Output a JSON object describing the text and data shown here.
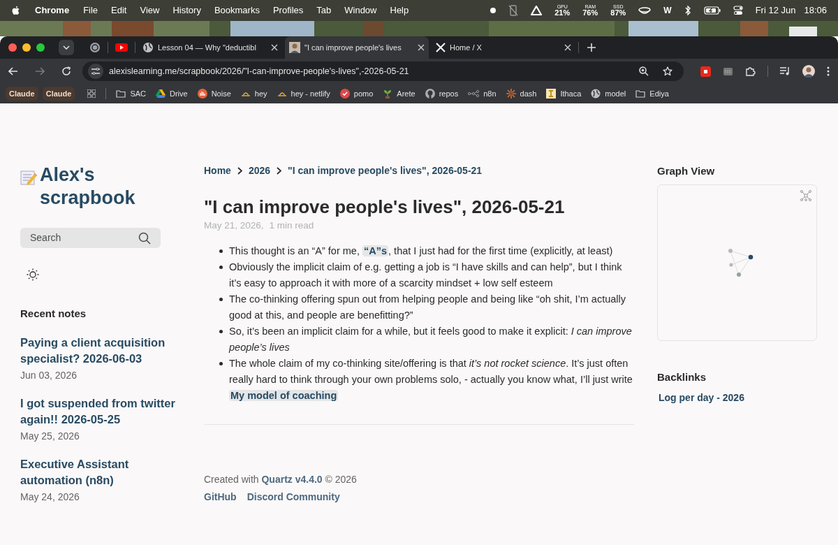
{
  "menu_bar": {
    "app": "Chrome",
    "items": [
      "File",
      "Edit",
      "View",
      "History",
      "Bookmarks",
      "Profiles",
      "Tab",
      "Window",
      "Help"
    ],
    "stats": [
      {
        "label": "GPU",
        "value": "21%"
      },
      {
        "label": "RAM",
        "value": "76%"
      },
      {
        "label": "SSD",
        "value": "87%"
      }
    ],
    "w_label": "W",
    "date": "Fri 12 Jun",
    "time": "18:06"
  },
  "tabs": [
    {
      "title": "Lesson 04 — Why \"deductibl",
      "selected": false,
      "kind": "globe"
    },
    {
      "title": "\"I can improve people's lives",
      "selected": true,
      "kind": "avatar"
    },
    {
      "title": "Home / X",
      "selected": false,
      "kind": "x"
    }
  ],
  "url": "alexislearning.me/scrapbook/2026/\"I-can-improve-people's-lives\",-2026-05-21",
  "bookmarks": [
    {
      "label": "Claude",
      "kind": "badge"
    },
    {
      "label": "Claude",
      "kind": "badge"
    },
    {
      "label": "SAC",
      "kind": "folder"
    },
    {
      "label": "Drive",
      "kind": "drive"
    },
    {
      "label": "Noise",
      "kind": "noise"
    },
    {
      "label": "hey",
      "kind": "hey"
    },
    {
      "label": "hey - netlify",
      "kind": "hey"
    },
    {
      "label": "pomo",
      "kind": "pomo"
    },
    {
      "label": "Arete",
      "kind": "sprout"
    },
    {
      "label": "repos",
      "kind": "github"
    },
    {
      "label": "n8n",
      "kind": "n8n"
    },
    {
      "label": "dash",
      "kind": "dash"
    },
    {
      "label": "Ithaca",
      "kind": "ithaca"
    },
    {
      "label": "model",
      "kind": "globe"
    },
    {
      "label": "Ediya",
      "kind": "folder"
    }
  ],
  "sidebar": {
    "site_title": "Alex's scrapbook",
    "search_placeholder": "Search",
    "recent_heading": "Recent notes",
    "recent_notes": [
      {
        "title": "Paying a client acquisition specialist? 2026-06-03",
        "date": "Jun 03, 2026"
      },
      {
        "title": "I got suspended from twitter again!! 2026-05-25",
        "date": "May 25, 2026"
      },
      {
        "title": "Executive Assistant automation (n8n)",
        "date": "May 24, 2026"
      }
    ]
  },
  "breadcrumbs": [
    "Home",
    "2026",
    "\"I can improve people's lives\", 2026-05-21"
  ],
  "article": {
    "title": "\"I can improve people's lives\", 2026-05-21",
    "meta": [
      "May 21, 2026,",
      "1 min read"
    ],
    "bullets": [
      [
        {
          "kind": "text",
          "text": "This thought is an “A” for me, "
        },
        {
          "kind": "link",
          "text": "“A”s"
        },
        {
          "kind": "text",
          "text": ", that I just had for the first time (explicitly, at least)"
        }
      ],
      [
        {
          "kind": "text",
          "text": "Obviously the implicit claim of e.g. getting a job is “I have skills and can help”, but I think it’s easy to approach it with more of a scarcity mindset + low self esteem"
        }
      ],
      [
        {
          "kind": "text",
          "text": "The co-thinking offering spun out from helping people and being like “oh shit, I’m actually good at this, and people are benefitting?”"
        }
      ],
      [
        {
          "kind": "text",
          "text": "So, it’s been an implicit claim for a while, but it feels good to make it explicit: *I can improve people’s lives*"
        }
      ],
      [
        {
          "kind": "text",
          "text": "The whole claim of my co-thinking site/offering is that *it’s not rocket science*. It’s just often really hard to think through your own problems solo, - actually you know what, I’ll just write "
        },
        {
          "kind": "link",
          "text": "My model of coaching"
        }
      ]
    ]
  },
  "footer": {
    "credit": [
      {
        "kind": "text",
        "text": "Created with "
      },
      {
        "kind": "link",
        "text": "Quartz v4.4.0"
      },
      {
        "kind": "text",
        "text": " © 2026"
      }
    ],
    "links": [
      "GitHub",
      "Discord Community"
    ]
  },
  "right": {
    "graph_heading": "Graph View",
    "backlinks_heading": "Backlinks",
    "backlinks": [
      "Log per day - 2026"
    ]
  }
}
